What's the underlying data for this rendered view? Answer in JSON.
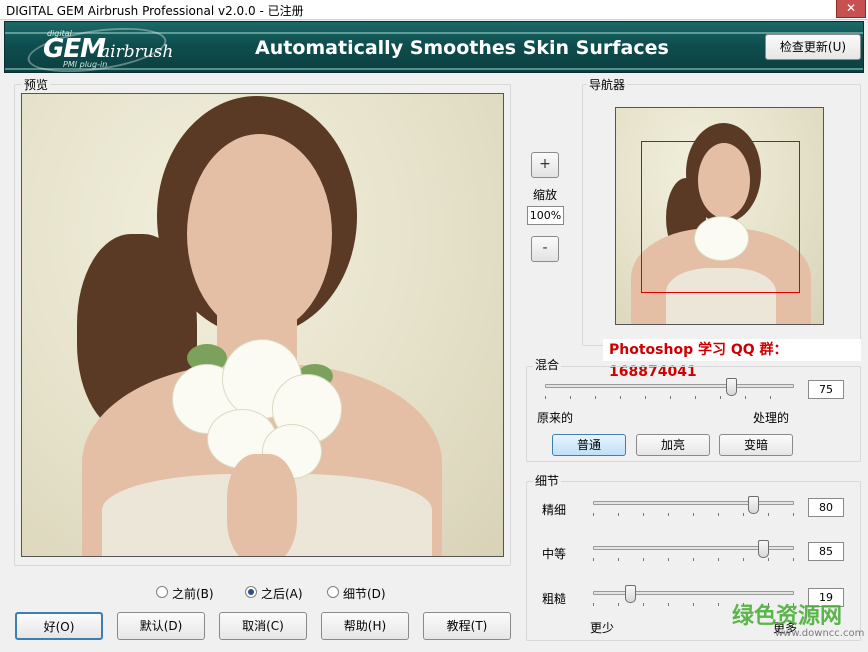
{
  "window": {
    "title": "DIGITAL GEM Airbrush Professional v2.0.0 - 已注册",
    "close_glyph": "✕"
  },
  "banner": {
    "logo_top": "digital",
    "logo_main": "GEM",
    "logo_sub": "airbrush",
    "logo_plugin": "PMI plug-in",
    "tagline": "Automatically Smoothes Skin Surfaces",
    "check_update_label": "检查更新(U)"
  },
  "preview": {
    "label": "预览"
  },
  "zoom": {
    "plus_label": "+",
    "label": "缩放",
    "value": "100%",
    "minus_label": "-"
  },
  "navigator": {
    "label": "导航器"
  },
  "watermark": {
    "qq_text": "Photoshop 学习 QQ 群：168874041",
    "site_text": "绿色资源网",
    "site_url": "www.downcc.com"
  },
  "blend": {
    "label": "混合",
    "value": "75",
    "value_fraction": 0.75,
    "left_label": "原来的",
    "right_label": "处理的",
    "modes": [
      {
        "label": "普通",
        "active": true
      },
      {
        "label": "加亮",
        "active": false
      },
      {
        "label": "变暗",
        "active": false
      }
    ]
  },
  "detail": {
    "label": "细节",
    "sliders": [
      {
        "label": "精细",
        "value": "80",
        "fraction": 0.8
      },
      {
        "label": "中等",
        "value": "85",
        "fraction": 0.85
      },
      {
        "label": "粗糙",
        "value": "19",
        "fraction": 0.19
      }
    ],
    "less_label": "更少",
    "more_label": "更多"
  },
  "view_options": [
    {
      "label": "之前(B)",
      "checked": false
    },
    {
      "label": "之后(A)",
      "checked": true
    },
    {
      "label": "细节(D)",
      "checked": false
    }
  ],
  "buttons": {
    "ok": "好(O)",
    "default": "默认(D)",
    "cancel": "取消(C)",
    "help": "帮助(H)",
    "tutorial": "教程(T)"
  }
}
